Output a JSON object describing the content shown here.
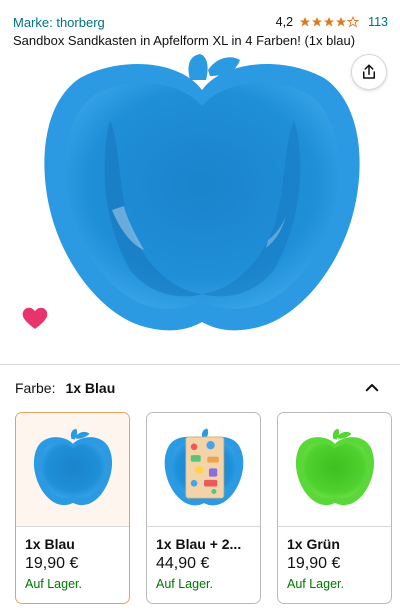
{
  "header": {
    "brand": "Marke: thorberg",
    "rating_value": "4,2",
    "rating_count": "113",
    "stars": 4.2,
    "title": "Sandbox Sandkasten in Apfelform XL in 4 Farben! (1x blau)"
  },
  "colors": {
    "accent_link": "#007185",
    "star": "#de7921",
    "apple_blue": "#1e8fd8",
    "apple_green": "#4fd12e",
    "heart": "#e8336d",
    "in_stock": "#007600",
    "selected_border": "#e3a25f"
  },
  "variants": {
    "label": "Farbe:",
    "selected": "1x Blau",
    "items": [
      {
        "name": "1x Blau",
        "price": "19,90 €",
        "stock": "Auf Lager."
      },
      {
        "name": "1x Blau + 2...",
        "price": "44,90 €",
        "stock": "Auf Lager."
      },
      {
        "name": "1x Grün",
        "price": "19,90 €",
        "stock": "Auf Lager."
      }
    ]
  }
}
